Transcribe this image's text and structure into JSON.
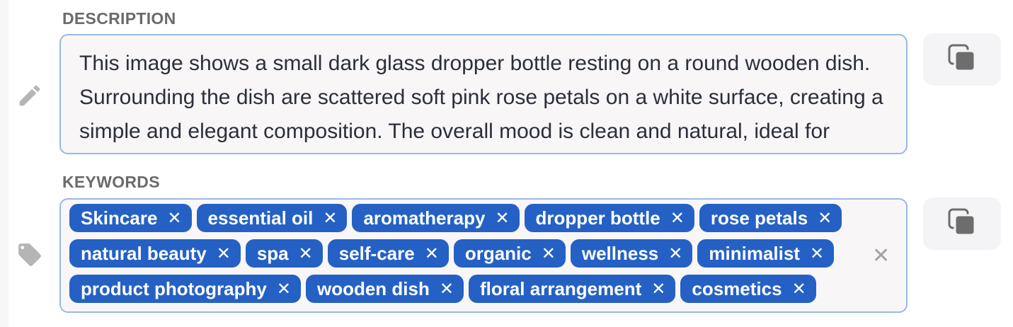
{
  "description": {
    "label": "DESCRIPTION",
    "text": "This image shows a small dark glass dropper bottle resting on a round wooden dish. Surrounding the dish are scattered soft pink rose petals on a white surface, creating a simple and elegant composition. The overall mood is clean and natural, ideal for promoting beauty and wellness products.",
    "edit_icon": "pencil-icon",
    "copy_icon": "copy-icon"
  },
  "keywords": {
    "label": "KEYWORDS",
    "tag_icon": "tag-icon",
    "copy_icon": "copy-icon",
    "clear_icon": "close-icon",
    "clear_symbol": "✕",
    "remove_symbol": "✕",
    "items": [
      "Skincare",
      "essential oil",
      "aromatherapy",
      "dropper bottle",
      "rose petals",
      "natural beauty",
      "spa",
      "self-care",
      "organic",
      "wellness",
      "minimalist",
      "product photography",
      "wooden dish",
      "floral arrangement",
      "cosmetics"
    ]
  },
  "colors": {
    "chip_background": "#2561c4",
    "border": "#9ab8e3",
    "field_background": "#f8f6f7",
    "label": "#6b6b6b"
  }
}
